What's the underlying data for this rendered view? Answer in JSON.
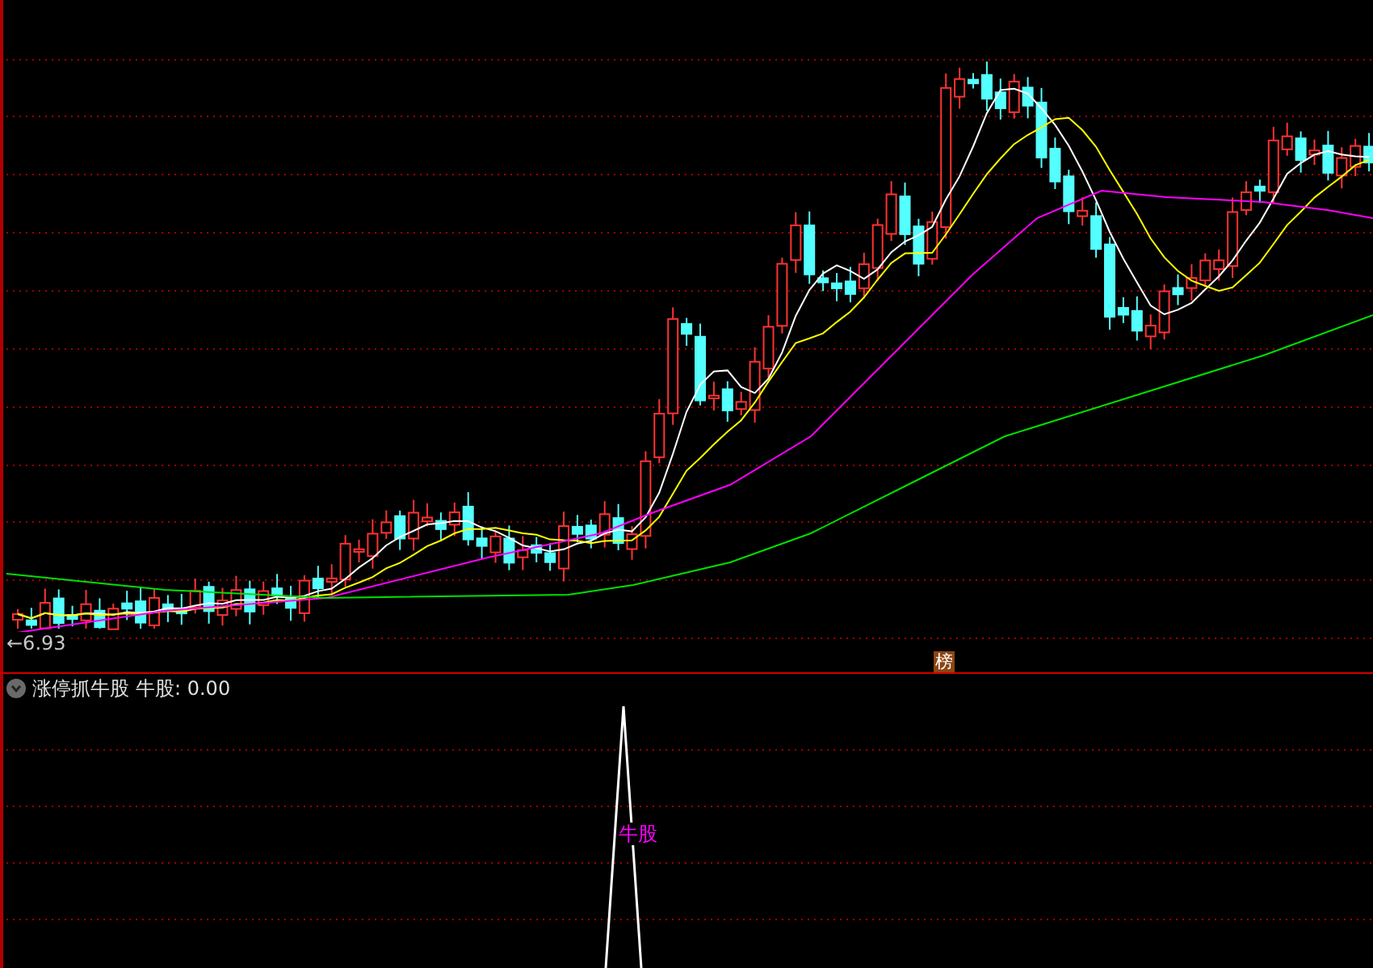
{
  "main_chart": {
    "low_price_label": "←6.93",
    "badge": "榜"
  },
  "indicator_panel": {
    "title": "涨停抓牛股",
    "reading": "牛股: 0.00",
    "signal_label": "牛股"
  }
}
